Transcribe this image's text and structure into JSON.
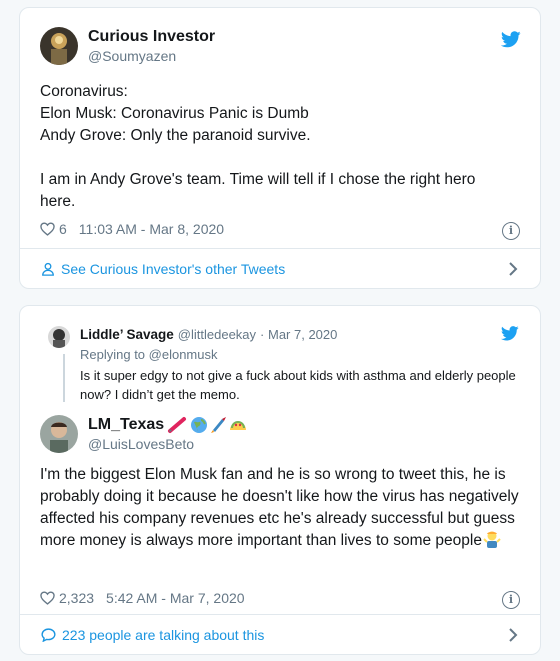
{
  "tweet1": {
    "author_name": "Curious Investor",
    "author_handle": "@Soumyazen",
    "text": "Coronavirus:\nElon Musk: Coronavirus Panic is Dumb\nAndy Grove: Only the paranoid survive.\n\nI am in Andy Grove's team. Time will tell if I chose the right hero here.",
    "likes": "6",
    "timestamp": "11:03 AM - Mar 8, 2020",
    "footer_link": "See Curious Investor's other Tweets"
  },
  "tweet2": {
    "quoted": {
      "author_name": "Liddle’ Savage",
      "author_handle": "@littledeekay",
      "date": "· Mar 7, 2020",
      "replying_to": "Replying to @elonmusk",
      "text": "Is it super edgy to not give a fuck about kids with asthma and elderly people now? I didn’t get the memo."
    },
    "author_name": "LM_Texas",
    "author_handle": "@LuisLovesBeto",
    "text": "I'm the biggest Elon Musk fan and he is so wrong to tweet this, he is probably doing it because he doesn't like how the virus has negatively affected his company revenues etc he's already successful but guess more money is always more important than lives to some people",
    "likes": "2,323",
    "timestamp": "5:42 AM - Mar 7, 2020",
    "footer_link": "223 people are talking about this"
  },
  "icons": {
    "twitter_bird": "twitter-bird-icon",
    "heart": "heart-icon",
    "info": "info-icon",
    "person": "person-icon",
    "comment": "comment-icon",
    "chevron": "chevron-right-icon"
  },
  "colors": {
    "accent": "#1da1f2",
    "link": "#1b95e0",
    "muted": "#657786",
    "border": "#e1e8ed"
  }
}
